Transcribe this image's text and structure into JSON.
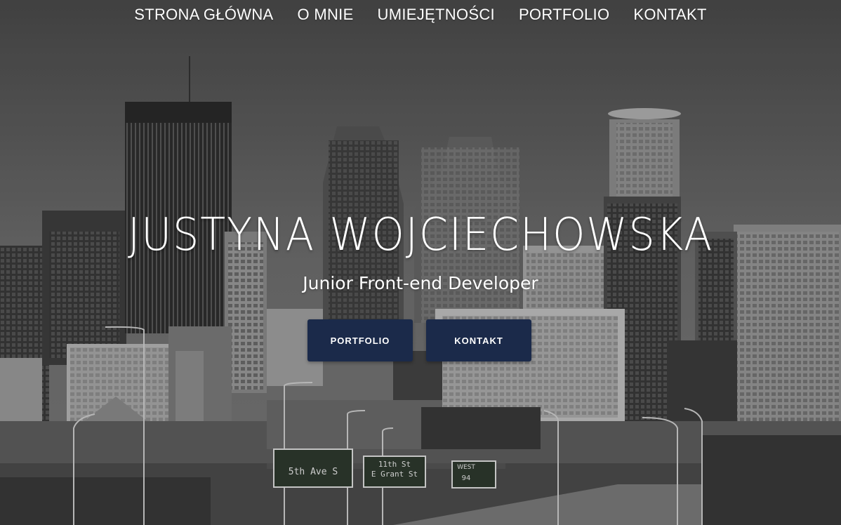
{
  "nav": {
    "items": [
      {
        "label": "STRONA GŁÓWNA"
      },
      {
        "label": "O MNIE"
      },
      {
        "label": "UMIEJĘTNOŚCI"
      },
      {
        "label": "PORTFOLIO"
      },
      {
        "label": "KONTAKT"
      }
    ]
  },
  "hero": {
    "title": "JUSTYNA WOJCIECHOWSKA",
    "subtitle": "Junior Front-end Developer",
    "buttons": {
      "portfolio": "PORTFOLIO",
      "kontakt": "KONTAKT"
    },
    "signs": {
      "sign1": "5th Ave S",
      "sign2_line1": "11th St",
      "sign2_line2": "E Grant St",
      "sign3_line1": "WEST",
      "sign3_route": "94"
    }
  },
  "colors": {
    "button_bg": "#1b2a4a",
    "text": "#ffffff"
  }
}
